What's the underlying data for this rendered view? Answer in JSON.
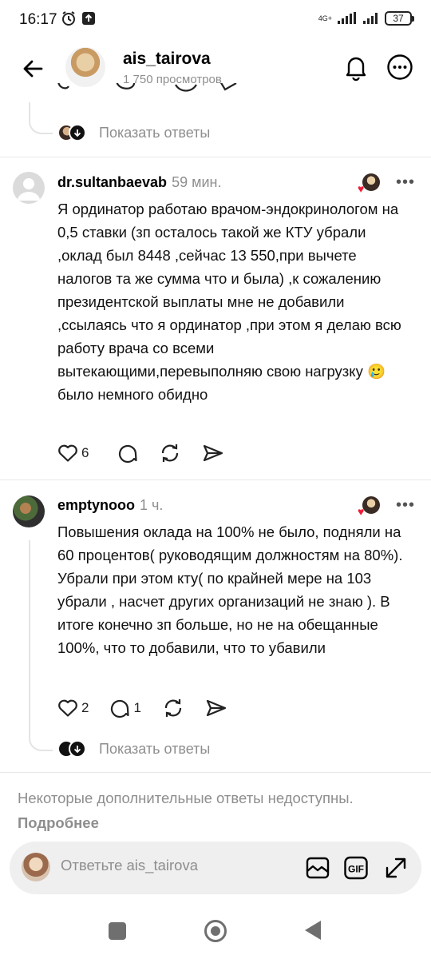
{
  "status_bar": {
    "time": "16:17",
    "network": "4G+",
    "battery": "37"
  },
  "header": {
    "title": "ais_tairova",
    "views": "1 750 просмотров"
  },
  "top_thread": {
    "show_replies": "Показать ответы"
  },
  "comments": [
    {
      "username": "dr.sultanbaevab",
      "time": "59 мин.",
      "text": "Я ординатор работаю врачом-эндокринологом на 0,5 ставки (зп осталось такой же КТУ убрали ,оклад был 8448 ,сейчас 13 550,при вычете налогов та же сумма что и была) ,к сожалению президентской выплаты мне не добавили ,ссылаясь что я ординатор ,при этом я делаю всю работу врача со всеми вытекающими,перевыполняю свою нагрузку 🥲было немного обидно",
      "likes": "6",
      "replies": ""
    },
    {
      "username": "emptynooo",
      "time": "1 ч.",
      "text": "Повышения оклада на 100% не было, подняли на 60 процентов( руководящим должностям на 80%). Убрали при этом кту( по крайней мере на 103 убрали , насчет других организаций не знаю ). В итоге конечно зп больше, но не на обещанные 100%, что то добавили, что то убавили",
      "likes": "2",
      "replies": "1",
      "show_replies": "Показать ответы"
    }
  ],
  "footer_note": {
    "unavailable": "Некоторые дополнительные ответы недоступны.",
    "more": "Подробнее"
  },
  "reply_bar": {
    "placeholder": "Ответьте ais_tairova",
    "gif_label": "GIF"
  }
}
